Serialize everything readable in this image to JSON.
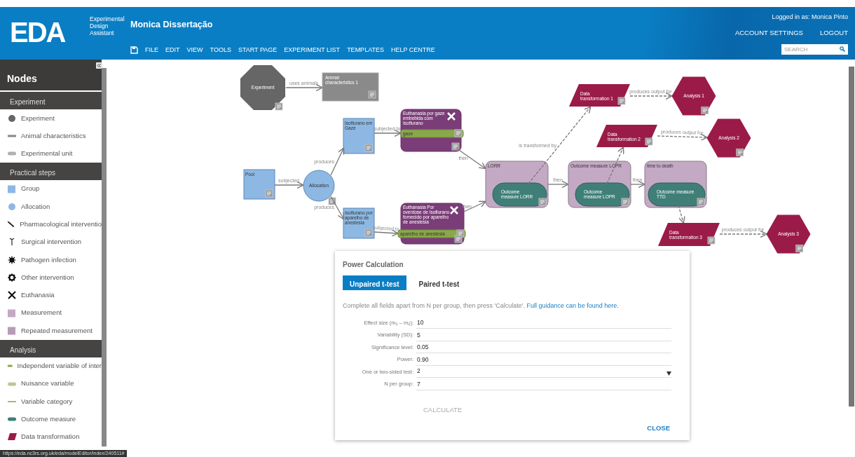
{
  "header": {
    "logo": "EDA",
    "logo_subtitle": [
      "Experimental",
      "Design",
      "Assistant"
    ],
    "project_title": "Monica Dissertação",
    "menu": [
      "FILE",
      "EDIT",
      "VIEW",
      "TOOLS",
      "START PAGE",
      "EXPERIMENT LIST",
      "TEMPLATES",
      "HELP CENTRE"
    ],
    "user": "Logged in as: Monica Pinto",
    "account_links": [
      "ACCOUNT SETTINGS",
      "LOGOUT"
    ],
    "search": {
      "placeholder": "SEARCH"
    }
  },
  "sidebar": {
    "title": "Nodes",
    "sections": [
      {
        "heading": "Experiment",
        "items": [
          {
            "label": "Experiment",
            "kind": "circle",
            "color": "#666666"
          },
          {
            "label": "Animal characteristics",
            "kind": "bar",
            "color": "#888888"
          },
          {
            "label": "Experimental unit",
            "kind": "pill",
            "color": "#b0b0b0"
          }
        ]
      },
      {
        "heading": "Practical steps",
        "items": [
          {
            "label": "Group",
            "kind": "square",
            "color": "#8db8e3"
          },
          {
            "label": "Allocation",
            "kind": "circle",
            "color": "#8db8e3"
          },
          {
            "label": "Pharmacological interventio",
            "kind": "syringe"
          },
          {
            "label": "Surgical intervention",
            "kind": "scalpel"
          },
          {
            "label": "Pathogen infection",
            "kind": "virus"
          },
          {
            "label": "Other intervention",
            "kind": "gear"
          },
          {
            "label": "Euthanasia",
            "kind": "cross"
          },
          {
            "label": "Measurement",
            "kind": "square",
            "color": "#c4a9c4"
          },
          {
            "label": "Repeated measurement",
            "kind": "square",
            "color": "#b79cb7"
          }
        ]
      },
      {
        "heading": "Analysis",
        "items": [
          {
            "label": "Independent variable of inter",
            "kind": "pill",
            "color": "#8aa84a"
          },
          {
            "label": "Nuisance variable",
            "kind": "pill",
            "color": "#b9c894"
          },
          {
            "label": "Variable category",
            "kind": "line",
            "color": "#a9b97a"
          },
          {
            "label": "Outcome measure",
            "kind": "pill",
            "color": "#3f7f78"
          },
          {
            "label": "Data transformation",
            "kind": "parallelogram",
            "color": "#9b1b48"
          }
        ]
      }
    ]
  },
  "diagram": {
    "nodes": [
      {
        "kind": "experiment",
        "label": "Experiment"
      },
      {
        "kind": "animal_characteristics",
        "label": "Animal characteristics 1"
      },
      {
        "kind": "group",
        "label": "Pool"
      },
      {
        "kind": "allocation",
        "label": "Allocation"
      },
      {
        "kind": "group",
        "label": "Isoflurano em Gaze"
      },
      {
        "kind": "group",
        "label": "Isoflurano por aparelho de anestesia"
      },
      {
        "kind": "euthanasia",
        "label": "Euthanasia por gaze embebida com Isoflurano",
        "variable": "gaze"
      },
      {
        "kind": "euthanasia",
        "label": "Euthanasia Por overdose de Isoflurano fornecido por aparelho de anestesia",
        "variable": "aparelho de anestesia"
      },
      {
        "kind": "measurement",
        "label": "LORR",
        "outcome": "Outcome measure LORR"
      },
      {
        "kind": "measurement",
        "label": "Outcome measure LOPR",
        "outcome": "Outcome measure LOPR"
      },
      {
        "kind": "measurement",
        "label": "time to death",
        "outcome": "Outcome measure TTD"
      },
      {
        "kind": "transformation",
        "label": "Data transformation 1"
      },
      {
        "kind": "analysis",
        "label": "Analysis 1"
      },
      {
        "kind": "transformation",
        "label": "Data transformation 2"
      },
      {
        "kind": "analysis",
        "label": "Analysis 2"
      },
      {
        "kind": "transformation",
        "label": "Data transformation 3"
      },
      {
        "kind": "analysis",
        "label": "Analysis 3"
      }
    ],
    "edges": [
      {
        "label": "uses animals"
      },
      {
        "label": "subjected"
      },
      {
        "label": "produces"
      },
      {
        "label": "produces"
      },
      {
        "label": "subjected to"
      },
      {
        "label": "subjected to"
      },
      {
        "label": "then"
      },
      {
        "label": "then"
      },
      {
        "label": "then"
      },
      {
        "label": "then"
      },
      {
        "label": "is transformed by"
      },
      {
        "label": "produces output for"
      },
      {
        "label": "produces output for"
      },
      {
        "label": "produces output for"
      }
    ]
  },
  "dialog": {
    "title": "Power Calculation",
    "tabs": [
      {
        "label": "Unpaired t-test",
        "selected": true
      },
      {
        "label": "Paired t-test",
        "selected": false
      }
    ],
    "instructions": "Complete all fields apart from N per group, then press 'Calculate'.",
    "guidance_link": "Full guidance can be found here.",
    "fields": [
      {
        "label": "Effect size (m$_{1}$ – m$_{2}$):",
        "value": "10",
        "kind": "text"
      },
      {
        "label": "Variability (SD):",
        "value": "5",
        "kind": "text"
      },
      {
        "label": "Significance level:",
        "value": "0.05",
        "kind": "text"
      },
      {
        "label": "Power:",
        "value": "0.90",
        "kind": "text"
      },
      {
        "label": "One or two-sided test:",
        "value": "2",
        "kind": "select"
      },
      {
        "label": "N per group:",
        "value": "7",
        "kind": "text"
      }
    ],
    "buttons": [
      {
        "label": "CALCULATE",
        "disabled": true
      },
      {
        "label": "CLOSE",
        "disabled": false
      }
    ]
  },
  "status_url": "https://eda.nc3rs.org.uk/eda/modelEditor/index/240511#"
}
